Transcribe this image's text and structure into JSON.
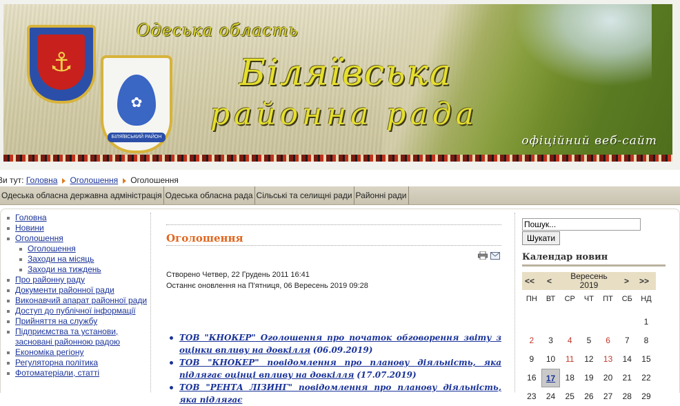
{
  "header": {
    "region": "Одеська область",
    "title_line1": "Біляївська",
    "title_line2": "районна рада",
    "official": "офіційний веб-сайт",
    "coat_ribbon": "БІЛЯЇВСЬКИЙ РАЙОН"
  },
  "breadcrumb": {
    "prefix": "Ви тут:",
    "items": [
      "Головна",
      "Оголошення"
    ],
    "current": "Оголошення"
  },
  "topnav": [
    "Одеська обласна державна адміністрація",
    "Одеська обласна рада",
    "Сільські та селищні ради",
    "Районні ради"
  ],
  "leftmenu": {
    "items": [
      {
        "label": "Головна"
      },
      {
        "label": "Новини"
      },
      {
        "label": "Оголошення"
      },
      {
        "label": "Оголошення",
        "sub": true
      },
      {
        "label": "Заходи на місяць",
        "sub": true
      },
      {
        "label": "Заходи на тиждень",
        "sub": true
      },
      {
        "label": "Про районну раду"
      },
      {
        "label": "Документи районної ради"
      },
      {
        "label": "Виконавчий апарат районної ради"
      },
      {
        "label": "Доступ до публічної інформації"
      },
      {
        "label": "Прийняття на службу"
      },
      {
        "label": "Підприємства та установи, засновані районною радою"
      },
      {
        "label": "Економіка регіону"
      },
      {
        "label": "Регуляторна політика"
      },
      {
        "label": "Фотоматеріали, статті"
      }
    ]
  },
  "main": {
    "title": "Оголошення",
    "created": "Створено Четвер, 22 Грудень 2011 16:41",
    "updated": "Останнє оновлення на П'ятниця, 06 Вересень 2019 09:28",
    "news": [
      {
        "org": "ТОВ \"КНОКЕР\"",
        "text": "Оголошення про початок обговорення звіту з оцінки впливу на довкілля",
        "date": "(06.09.2019)"
      },
      {
        "org": "ТОВ \"КНОКЕР\"",
        "text": "повідомлення про планову діяльність, яка підлягає оцінці впливу на довкілля",
        "date": "(17.07.2019)"
      },
      {
        "org": "ТОВ \"РЕНТА ЛІЗИНГ\"",
        "text": "повідомлення про планову діяльність, яка підлягає",
        "date": ""
      }
    ]
  },
  "search": {
    "placeholder": "Пошук...",
    "button": "Шукати"
  },
  "calendar": {
    "heading": "Календар новин",
    "prev_year": "<<",
    "prev_month": "<",
    "next_month": ">",
    "next_year": ">>",
    "month_line1": "Вересень",
    "month_line2": "2019",
    "weekdays": [
      "ПН",
      "ВТ",
      "СР",
      "ЧТ",
      "ПТ",
      "СБ",
      "НД"
    ],
    "weeks": [
      [
        "",
        "",
        "",
        "",
        "",
        "",
        "1"
      ],
      [
        "2",
        "3",
        "4",
        "5",
        "6",
        "7",
        "8"
      ],
      [
        "9",
        "10",
        "11",
        "12",
        "13",
        "14",
        "15"
      ],
      [
        "16",
        "17",
        "18",
        "19",
        "20",
        "21",
        "22"
      ],
      [
        "23",
        "24",
        "25",
        "26",
        "27",
        "28",
        "29"
      ]
    ],
    "news_days": [
      "2",
      "4",
      "6",
      "11",
      "13"
    ],
    "today": "17"
  },
  "colors": {
    "link": "#1a3399",
    "title_accent": "#e0661e",
    "news_day": "#c0392b"
  }
}
